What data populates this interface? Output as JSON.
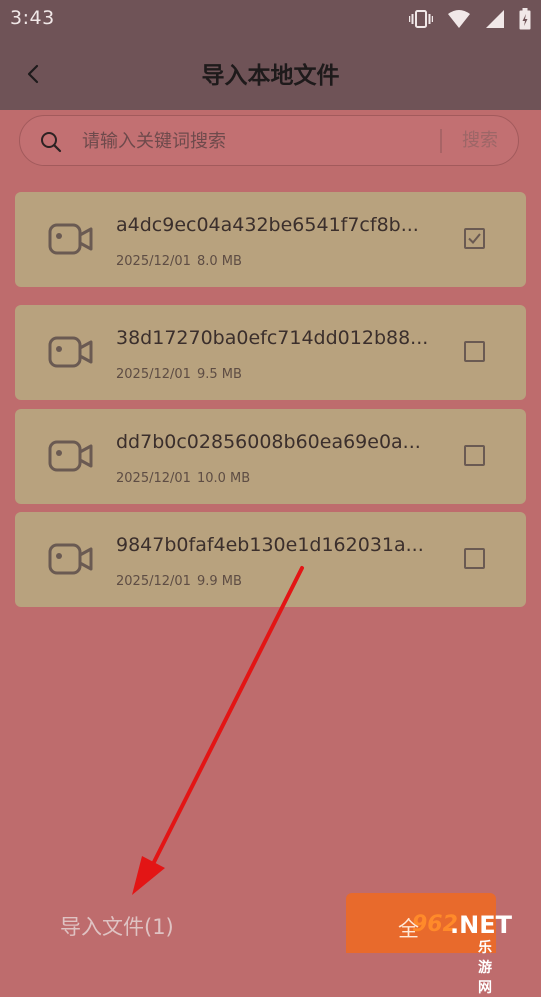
{
  "status_bar": {
    "time": "3:43"
  },
  "app_bar": {
    "title": "导入本地文件"
  },
  "search": {
    "placeholder": "请输入关键词搜索",
    "button_label": "搜索"
  },
  "files": [
    {
      "name": "a4dc9ec04a432be6541f7cf8b...",
      "date": "2025/12/01",
      "size": "8.0 MB",
      "checked": true
    },
    {
      "name": "38d17270ba0efc714dd012b88...",
      "date": "2025/12/01",
      "size": "9.5 MB",
      "checked": false
    },
    {
      "name": "dd7b0c02856008b60ea69e0a...",
      "date": "2025/12/01",
      "size": "10.0 MB",
      "checked": false
    },
    {
      "name": "9847b0faf4eb130e1d162031a...",
      "date": "2025/12/01",
      "size": "9.9 MB",
      "checked": false
    }
  ],
  "footer": {
    "import_label": "导入文件(1)",
    "select_all_label": "全"
  },
  "watermark": {
    "number": "962",
    "brand": ".NET",
    "sub": "乐游网"
  },
  "colors": {
    "accent": "#E86A2C",
    "card": "#B8A27E",
    "background": "#BE6C6D",
    "header": "#6F5357",
    "annotation": "#E31515"
  }
}
